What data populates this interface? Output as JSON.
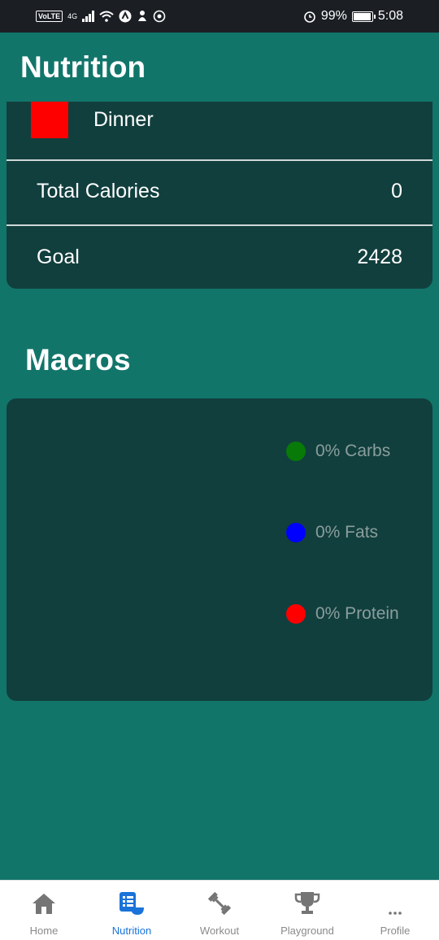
{
  "status_bar": {
    "left_badge": "VoLTE",
    "network": "4G",
    "battery_percent": "99%",
    "time": "5:08"
  },
  "page": {
    "title": "Nutrition"
  },
  "meal_card": {
    "meal_label": "Dinner",
    "meal_color": "#ff0000",
    "total_calories_label": "Total Calories",
    "total_calories_value": "0",
    "goal_label": "Goal",
    "goal_value": "2428"
  },
  "macros": {
    "title": "Macros",
    "items": [
      {
        "label": "0% Carbs",
        "color": "#087a08"
      },
      {
        "label": "0% Fats",
        "color": "#0000ff"
      },
      {
        "label": "0% Protein",
        "color": "#ff0000"
      }
    ]
  },
  "bottom_nav": {
    "active": "Nutrition",
    "items": [
      {
        "label": "Home",
        "icon": "home-icon"
      },
      {
        "label": "Nutrition",
        "icon": "nutrition-icon"
      },
      {
        "label": "Workout",
        "icon": "dumbbell-icon"
      },
      {
        "label": "Playground",
        "icon": "trophy-icon"
      },
      {
        "label": "Profile",
        "icon": "more-icon"
      }
    ]
  }
}
